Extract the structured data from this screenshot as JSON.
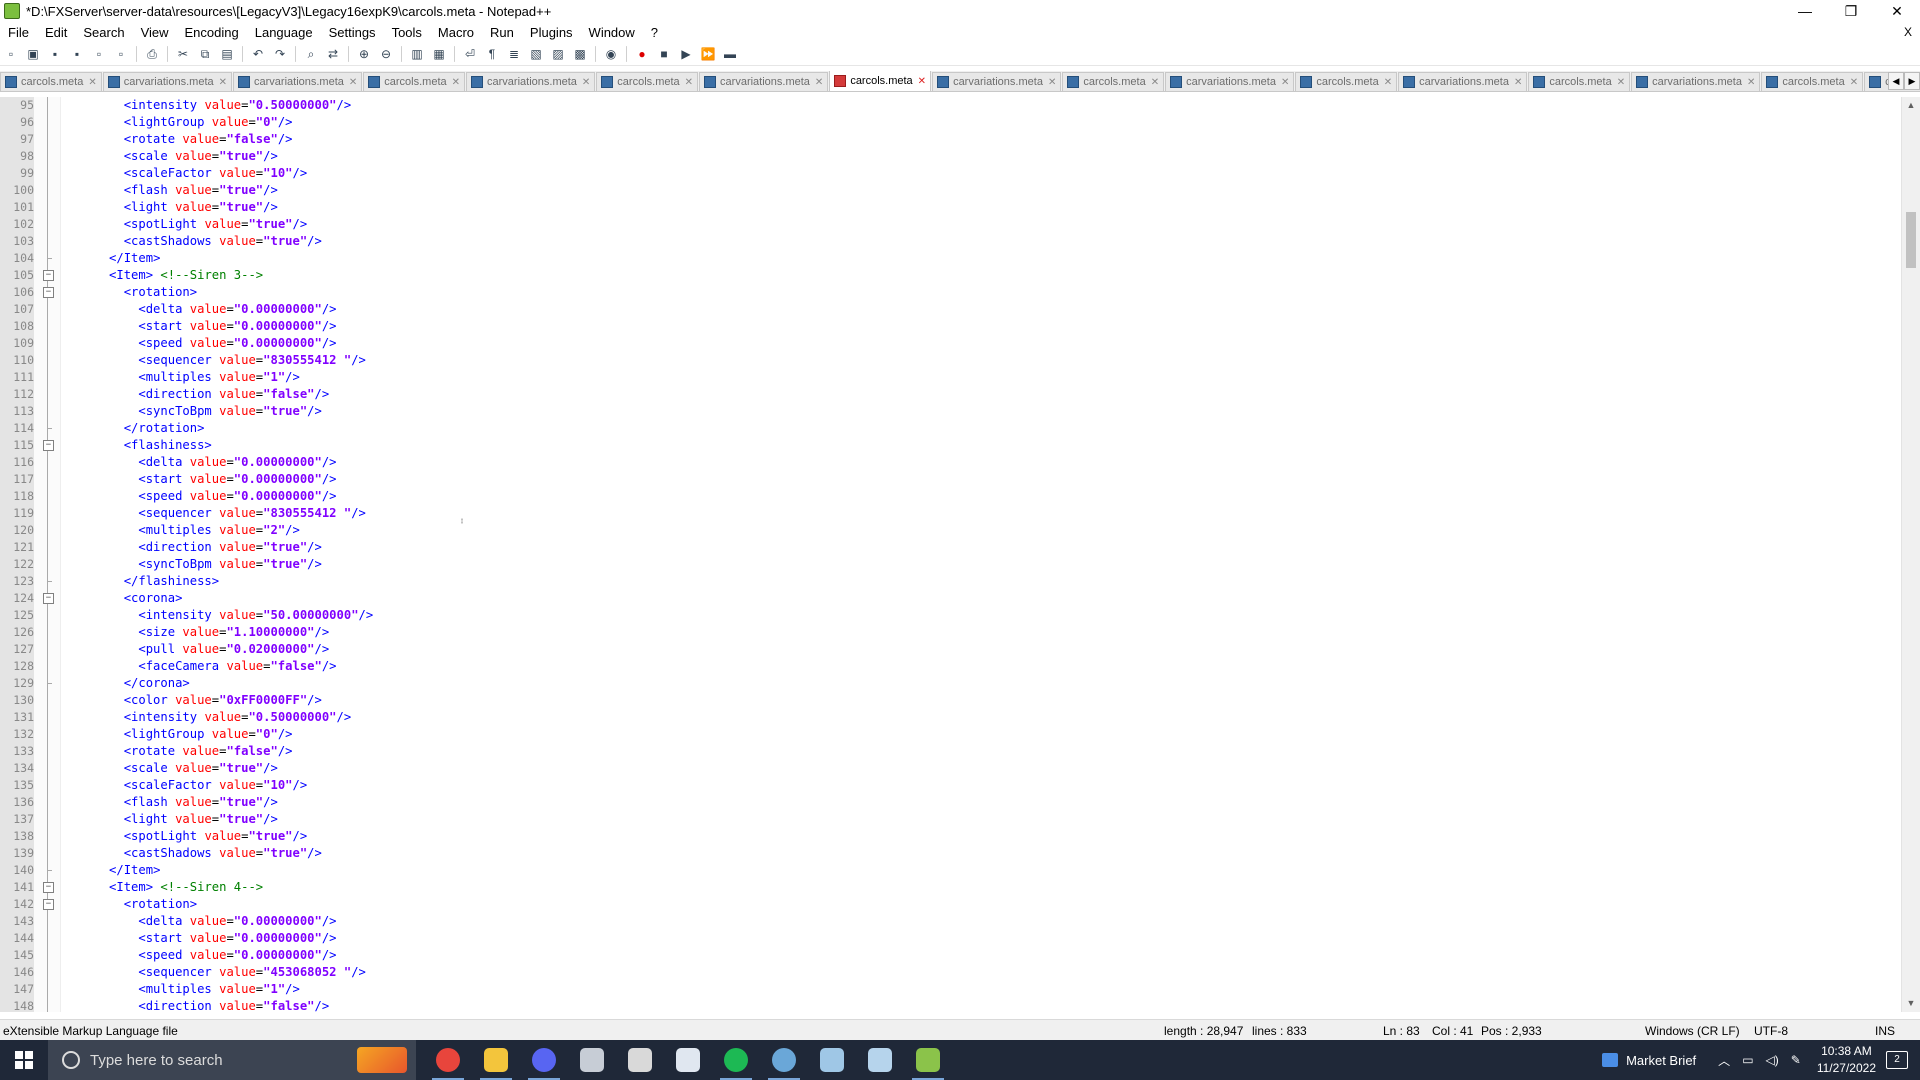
{
  "window": {
    "title": "*D:\\FXServer\\server-data\\resources\\[LegacyV3]\\Legacy16expK9\\carcols.meta - Notepad++",
    "minimize": "—",
    "restore": "❐",
    "close": "✕"
  },
  "menu": [
    "File",
    "Edit",
    "Search",
    "View",
    "Encoding",
    "Language",
    "Settings",
    "Tools",
    "Macro",
    "Run",
    "Plugins",
    "Window",
    "?"
  ],
  "menu_close": "X",
  "toolbar_icons": [
    "new-icon",
    "open-icon",
    "save-icon",
    "save-all-icon",
    "close-icon",
    "close-all-icon",
    "print-icon",
    "cut-icon",
    "copy-icon",
    "paste-icon",
    "undo-icon",
    "redo-icon",
    "find-icon",
    "replace-icon",
    "zoom-in-icon",
    "zoom-out-icon",
    "sync-v-icon",
    "sync-h-icon",
    "wrap-icon",
    "all-chars-icon",
    "indent-guide-icon",
    "doc-map-icon",
    "function-list-icon",
    "folder-workspace-icon",
    "monitor-icon",
    "record-macro-icon",
    "stop-macro-icon",
    "play-macro-icon",
    "run-macro-icon",
    "save-macro-icon"
  ],
  "tabs": [
    {
      "label": "carcols.meta",
      "active": false
    },
    {
      "label": "carvariations.meta",
      "active": false
    },
    {
      "label": "carvariations.meta",
      "active": false
    },
    {
      "label": "carcols.meta",
      "active": false
    },
    {
      "label": "carvariations.meta",
      "active": false
    },
    {
      "label": "carcols.meta",
      "active": false
    },
    {
      "label": "carvariations.meta",
      "active": false
    },
    {
      "label": "carcols.meta",
      "active": true
    },
    {
      "label": "carvariations.meta",
      "active": false
    },
    {
      "label": "carcols.meta",
      "active": false
    },
    {
      "label": "carvariations.meta",
      "active": false
    },
    {
      "label": "carcols.meta",
      "active": false
    },
    {
      "label": "carvariations.meta",
      "active": false
    },
    {
      "label": "carcols.meta",
      "active": false
    },
    {
      "label": "carvariations.meta",
      "active": false
    },
    {
      "label": "carcols.meta",
      "active": false
    },
    {
      "label": "carvariations",
      "active": false
    }
  ],
  "editor": {
    "lines": [
      {
        "n": "95",
        "t": "        <intensity value=\"0.50000000\"/>",
        "f": "line"
      },
      {
        "n": "96",
        "t": "        <lightGroup value=\"0\"/>",
        "f": "line"
      },
      {
        "n": "97",
        "t": "        <rotate value=\"false\"/>",
        "f": "line"
      },
      {
        "n": "98",
        "t": "        <scale value=\"true\"/>",
        "f": "line"
      },
      {
        "n": "99",
        "t": "        <scaleFactor value=\"10\"/>",
        "f": "line"
      },
      {
        "n": "100",
        "t": "        <flash value=\"true\"/>",
        "f": "line"
      },
      {
        "n": "101",
        "t": "        <light value=\"true\"/>",
        "f": "line"
      },
      {
        "n": "102",
        "t": "        <spotLight value=\"true\"/>",
        "f": "line"
      },
      {
        "n": "103",
        "t": "        <castShadows value=\"true\"/>",
        "f": "line"
      },
      {
        "n": "104",
        "t": "      </Item>",
        "f": "end"
      },
      {
        "n": "105",
        "t": "      <Item> <!--Siren 3-->",
        "f": "open"
      },
      {
        "n": "106",
        "t": "        <rotation>",
        "f": "open"
      },
      {
        "n": "107",
        "t": "          <delta value=\"0.00000000\"/>",
        "f": "line"
      },
      {
        "n": "108",
        "t": "          <start value=\"0.00000000\"/>",
        "f": "line"
      },
      {
        "n": "109",
        "t": "          <speed value=\"0.00000000\"/>",
        "f": "line"
      },
      {
        "n": "110",
        "t": "          <sequencer value=\"830555412 \"/>",
        "f": "line"
      },
      {
        "n": "111",
        "t": "          <multiples value=\"1\"/>",
        "f": "line"
      },
      {
        "n": "112",
        "t": "          <direction value=\"false\"/>",
        "f": "line"
      },
      {
        "n": "113",
        "t": "          <syncToBpm value=\"true\"/>",
        "f": "line"
      },
      {
        "n": "114",
        "t": "        </rotation>",
        "f": "end"
      },
      {
        "n": "115",
        "t": "        <flashiness>",
        "f": "open"
      },
      {
        "n": "116",
        "t": "          <delta value=\"0.00000000\"/>",
        "f": "line"
      },
      {
        "n": "117",
        "t": "          <start value=\"0.00000000\"/>",
        "f": "line"
      },
      {
        "n": "118",
        "t": "          <speed value=\"0.00000000\"/>",
        "f": "line"
      },
      {
        "n": "119",
        "t": "          <sequencer value=\"830555412 \"/>",
        "f": "line"
      },
      {
        "n": "120",
        "t": "          <multiples value=\"2\"/>",
        "f": "line"
      },
      {
        "n": "121",
        "t": "          <direction value=\"true\"/>",
        "f": "line"
      },
      {
        "n": "122",
        "t": "          <syncToBpm value=\"true\"/>",
        "f": "line"
      },
      {
        "n": "123",
        "t": "        </flashiness>",
        "f": "end"
      },
      {
        "n": "124",
        "t": "        <corona>",
        "f": "open"
      },
      {
        "n": "125",
        "t": "          <intensity value=\"50.00000000\"/>",
        "f": "line"
      },
      {
        "n": "126",
        "t": "          <size value=\"1.10000000\"/>",
        "f": "line"
      },
      {
        "n": "127",
        "t": "          <pull value=\"0.02000000\"/>",
        "f": "line"
      },
      {
        "n": "128",
        "t": "          <faceCamera value=\"false\"/>",
        "f": "line"
      },
      {
        "n": "129",
        "t": "        </corona>",
        "f": "end"
      },
      {
        "n": "130",
        "t": "        <color value=\"0xFF0000FF\"/>",
        "f": "line"
      },
      {
        "n": "131",
        "t": "        <intensity value=\"0.50000000\"/>",
        "f": "line"
      },
      {
        "n": "132",
        "t": "        <lightGroup value=\"0\"/>",
        "f": "line"
      },
      {
        "n": "133",
        "t": "        <rotate value=\"false\"/>",
        "f": "line"
      },
      {
        "n": "134",
        "t": "        <scale value=\"true\"/>",
        "f": "line"
      },
      {
        "n": "135",
        "t": "        <scaleFactor value=\"10\"/>",
        "f": "line"
      },
      {
        "n": "136",
        "t": "        <flash value=\"true\"/>",
        "f": "line"
      },
      {
        "n": "137",
        "t": "        <light value=\"true\"/>",
        "f": "line"
      },
      {
        "n": "138",
        "t": "        <spotLight value=\"true\"/>",
        "f": "line"
      },
      {
        "n": "139",
        "t": "        <castShadows value=\"true\"/>",
        "f": "line"
      },
      {
        "n": "140",
        "t": "      </Item>",
        "f": "end"
      },
      {
        "n": "141",
        "t": "      <Item> <!--Siren 4-->",
        "f": "open"
      },
      {
        "n": "142",
        "t": "        <rotation>",
        "f": "open"
      },
      {
        "n": "143",
        "t": "          <delta value=\"0.00000000\"/>",
        "f": "line"
      },
      {
        "n": "144",
        "t": "          <start value=\"0.00000000\"/>",
        "f": "line"
      },
      {
        "n": "145",
        "t": "          <speed value=\"0.00000000\"/>",
        "f": "line"
      },
      {
        "n": "146",
        "t": "          <sequencer value=\"453068052 \"/>",
        "f": "line"
      },
      {
        "n": "147",
        "t": "          <multiples value=\"1\"/>",
        "f": "line"
      },
      {
        "n": "148",
        "t": "          <direction value=\"false\"/>",
        "f": "line"
      }
    ]
  },
  "syntax_colors": {
    "tag": "#0000ff",
    "attr": "#ff0000",
    "value": "#8000ff",
    "comment": "#008000",
    "bracket": "#0000ff"
  },
  "status": {
    "filetype": "eXtensible Markup Language file",
    "length": "length : 28,947",
    "lines": "lines : 833",
    "ln": "Ln : 83",
    "col": "Col : 41",
    "pos": "Pos : 2,933",
    "eol": "Windows (CR LF)",
    "encoding": "UTF-8",
    "mode": "INS"
  },
  "taskbar": {
    "search_placeholder": "Type here to search",
    "apps": [
      {
        "name": "chrome-icon",
        "color": "#e8453c"
      },
      {
        "name": "file-explorer-icon",
        "color": "#f3c53c"
      },
      {
        "name": "discord-icon",
        "color": "#5865f2"
      },
      {
        "name": "app-icon",
        "color": "#c7cdd6"
      },
      {
        "name": "app-icon",
        "color": "#d9d9d9"
      },
      {
        "name": "app-icon",
        "color": "#e0e7f0"
      },
      {
        "name": "spotify-icon",
        "color": "#1db954"
      },
      {
        "name": "steam-icon",
        "color": "#6aa7d8"
      },
      {
        "name": "app-icon",
        "color": "#9fc7e6"
      },
      {
        "name": "app-icon",
        "color": "#b6d4ec"
      },
      {
        "name": "notepad-plus-plus-icon",
        "color": "#8bc34a"
      }
    ],
    "market_brief": "Market Brief",
    "time": "10:38 AM",
    "date": "11/27/2022",
    "notifications": "2"
  }
}
